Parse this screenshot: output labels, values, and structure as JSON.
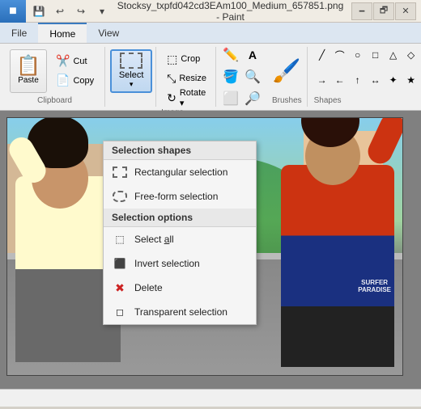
{
  "titleBar": {
    "title": "Stocksy_txpfd042cd3EAm100_Medium_657851.png - Paint",
    "minimize": "🗕",
    "maximize": "🗗",
    "close": "✕"
  },
  "quickAccess": {
    "save": "💾",
    "undo": "↩",
    "redo": "↪",
    "arrow": "▾"
  },
  "tabs": {
    "file": "File",
    "home": "Home",
    "view": "View"
  },
  "clipboard": {
    "paste": "Paste",
    "cut": "Cut",
    "copy": "Copy",
    "label": "Clipboard"
  },
  "select": {
    "label": "Select"
  },
  "imageGroup": {
    "crop": "Crop",
    "resize": "Resize",
    "rotate": "Rotate ▾",
    "label": "Image"
  },
  "brushes": {
    "label": "Brushes"
  },
  "shapes": {
    "label": "Shapes"
  },
  "dropdownMenu": {
    "sectionShapes": "Selection shapes",
    "rectangular": "Rectangular selection",
    "freeform": "Free-form selection",
    "sectionOptions": "Selection options",
    "selectAll": "Select all",
    "invert": "Invert selection",
    "delete": "Delete",
    "transparent": "Transparent selection"
  },
  "statusBar": {
    "info": ""
  }
}
